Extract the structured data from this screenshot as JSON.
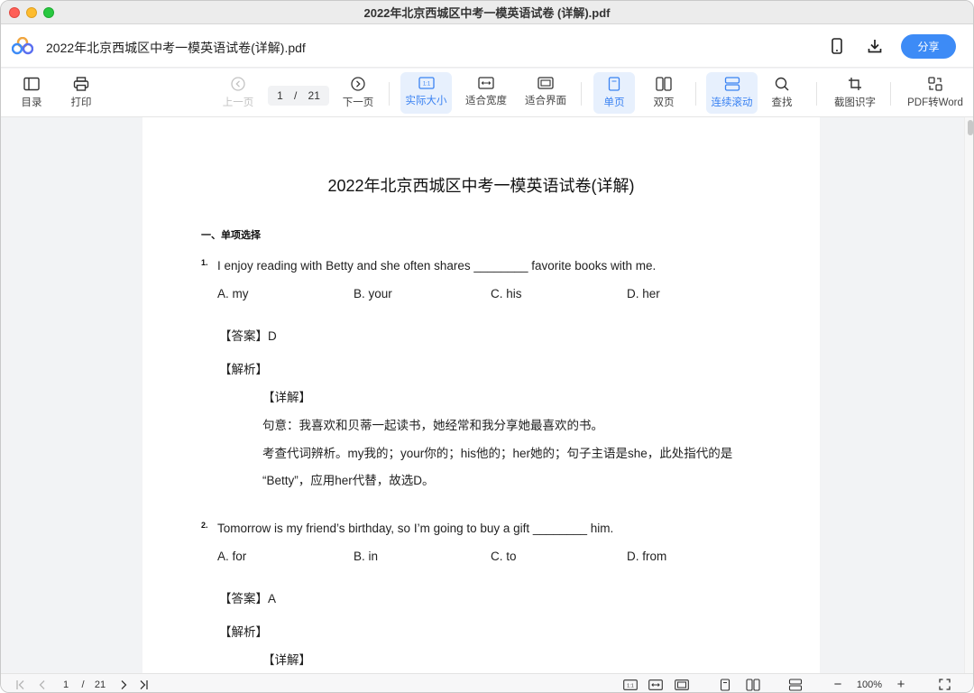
{
  "window": {
    "title": "2022年北京西城区中考一模英语试卷 (详解).pdf"
  },
  "header": {
    "doc_title": "2022年北京西城区中考一模英语试卷(详解).pdf",
    "share_label": "分享"
  },
  "toolbar": {
    "toc": "目录",
    "print": "打印",
    "prev_page": "上一页",
    "page_current": "1",
    "page_sep": "/",
    "page_total": "21",
    "next_page": "下一页",
    "actual_size": "实际大小",
    "actual_size_icon_text": "1:1",
    "fit_width": "适合宽度",
    "fit_page": "适合界面",
    "single_page": "单页",
    "double_page": "双页",
    "continuous_scroll": "连续滚动",
    "find": "查找",
    "ocr": "截图识字",
    "pdf_to_word": "PDF转Word"
  },
  "document": {
    "title": "2022年北京西城区中考一模英语试卷(详解)",
    "section": "一、单项选择",
    "questions": [
      {
        "num": "1.",
        "text": "I enjoy reading with Betty and she often shares ________ favorite books with me.",
        "options": [
          "A. my",
          "B. your",
          "C. his",
          "D. her"
        ],
        "answer": "【答案】D",
        "analysis": "【解析】",
        "detail": "【详解】",
        "lines": [
          "句意：我喜欢和贝蒂一起读书，她经常和我分享她最喜欢的书。",
          "考查代词辨析。my我的；your你的；his他的；her她的；句子主语是she，此处指代的是",
          "“Betty”，应用her代替，故选D。"
        ]
      },
      {
        "num": "2.",
        "text": "Tomorrow is my friend’s birthday, so I’m going to buy a gift ________ him.",
        "options": [
          "A. for",
          "B. in",
          "C. to",
          "D. from"
        ],
        "answer": "【答案】A",
        "analysis": "【解析】",
        "detail": "【详解】"
      }
    ]
  },
  "statusbar": {
    "page_current": "1",
    "page_sep": "/",
    "page_total": "21",
    "zoom": "100%",
    "zoom_out": "−",
    "zoom_in": "+",
    "actual_size_icon_text": "1:1"
  },
  "colors": {
    "accent": "#3d8bf6",
    "active_bg": "#e7f0fd",
    "active_text": "#3a82f2"
  }
}
